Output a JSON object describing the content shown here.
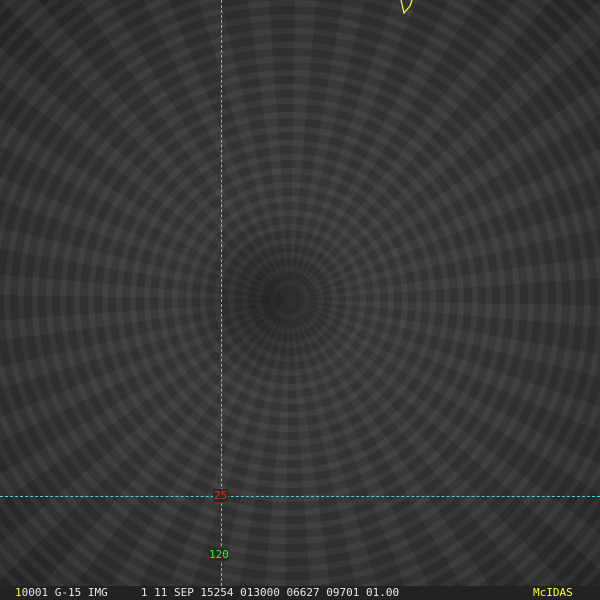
{
  "overlay": {
    "latitude_label": "25",
    "longitude_label": "120"
  },
  "status_bar": {
    "frame_number": "1",
    "info": "0001 G-15 IMG     1 11 SEP 15254 013000 06627 09701 01.00",
    "brand": "McIDAS"
  },
  "colors": {
    "grid": "#3fd6e0",
    "latitude": "#ff2020",
    "longitude": "#20ff20",
    "coastline": "#ffff30"
  }
}
